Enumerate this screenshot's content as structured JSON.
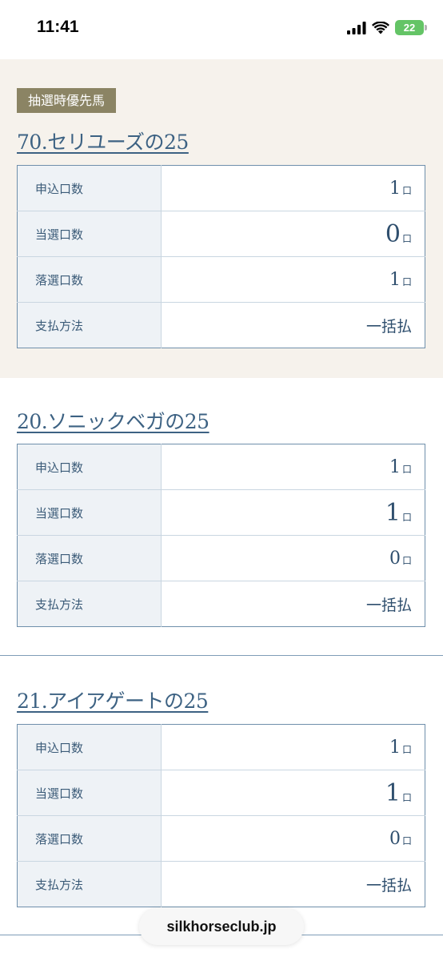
{
  "status_bar": {
    "time": "11:41",
    "battery": "22"
  },
  "badge": "抽選時優先馬",
  "horses": [
    {
      "title": "70.セリユーズの25",
      "rows": [
        {
          "label": "申込口数",
          "value": "1",
          "unit": "口"
        },
        {
          "label": "当選口数",
          "value": "0",
          "unit": "口"
        },
        {
          "label": "落選口数",
          "value": "1",
          "unit": "口"
        },
        {
          "label": "支払方法",
          "value": "一括払"
        }
      ]
    },
    {
      "title": "20.ソニックベガの25",
      "rows": [
        {
          "label": "申込口数",
          "value": "1",
          "unit": "口"
        },
        {
          "label": "当選口数",
          "value": "1",
          "unit": "口"
        },
        {
          "label": "落選口数",
          "value": "0",
          "unit": "口"
        },
        {
          "label": "支払方法",
          "value": "一括払"
        }
      ]
    },
    {
      "title": "21.アイアゲートの25",
      "rows": [
        {
          "label": "申込口数",
          "value": "1",
          "unit": "口"
        },
        {
          "label": "当選口数",
          "value": "1",
          "unit": "口"
        },
        {
          "label": "落選口数",
          "value": "0",
          "unit": "口"
        },
        {
          "label": "支払方法",
          "value": "一括払"
        }
      ]
    }
  ],
  "url_bar": {
    "domain": "silkhorseclub.jp"
  },
  "colors": {
    "badge": "#8b8464",
    "accent": "#3d6283",
    "section_bg": "#f6f2ec",
    "battery": "#64c466"
  }
}
